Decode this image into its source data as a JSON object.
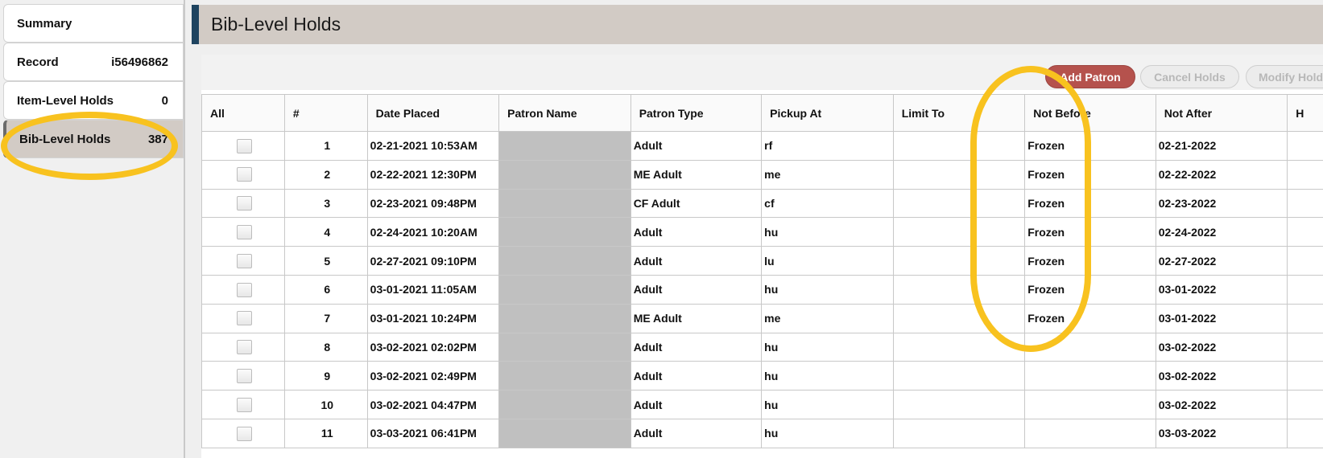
{
  "sidebar": {
    "items": [
      {
        "label": "Summary",
        "value": ""
      },
      {
        "label": "Record",
        "value": "i56496862"
      },
      {
        "label": "Item-Level Holds",
        "value": "0"
      },
      {
        "label": "Bib-Level Holds",
        "value": "387"
      }
    ]
  },
  "page": {
    "title": "Bib-Level Holds"
  },
  "toolbar": {
    "add_patron": "Add Patron",
    "cancel_holds": "Cancel Holds",
    "modify_holds": "Modify Holds"
  },
  "table": {
    "headers": [
      "All",
      "#",
      "Date Placed",
      "Patron Name",
      "Patron Type",
      "Pickup At",
      "Limit To",
      "Not Before",
      "Not After",
      "H"
    ],
    "rows": [
      {
        "num": "1",
        "date": "02-21-2021 10:53AM",
        "ptype": "Adult",
        "pickup": "rf",
        "limit": "",
        "notbefore": "Frozen",
        "notafter": "02-21-2022"
      },
      {
        "num": "2",
        "date": "02-22-2021 12:30PM",
        "ptype": "ME Adult",
        "pickup": "me",
        "limit": "",
        "notbefore": "Frozen",
        "notafter": "02-22-2022"
      },
      {
        "num": "3",
        "date": "02-23-2021 09:48PM",
        "ptype": "CF Adult",
        "pickup": "cf",
        "limit": "",
        "notbefore": "Frozen",
        "notafter": "02-23-2022"
      },
      {
        "num": "4",
        "date": "02-24-2021 10:20AM",
        "ptype": "Adult",
        "pickup": "hu",
        "limit": "",
        "notbefore": "Frozen",
        "notafter": "02-24-2022"
      },
      {
        "num": "5",
        "date": "02-27-2021 09:10PM",
        "ptype": "Adult",
        "pickup": "lu",
        "limit": "",
        "notbefore": "Frozen",
        "notafter": "02-27-2022"
      },
      {
        "num": "6",
        "date": "03-01-2021 11:05AM",
        "ptype": "Adult",
        "pickup": "hu",
        "limit": "",
        "notbefore": "Frozen",
        "notafter": "03-01-2022"
      },
      {
        "num": "7",
        "date": "03-01-2021 10:24PM",
        "ptype": "ME Adult",
        "pickup": "me",
        "limit": "",
        "notbefore": "Frozen",
        "notafter": "03-01-2022"
      },
      {
        "num": "8",
        "date": "03-02-2021 02:02PM",
        "ptype": "Adult",
        "pickup": "hu",
        "limit": "",
        "notbefore": "",
        "notafter": "03-02-2022"
      },
      {
        "num": "9",
        "date": "03-02-2021 02:49PM",
        "ptype": "Adult",
        "pickup": "hu",
        "limit": "",
        "notbefore": "",
        "notafter": "03-02-2022"
      },
      {
        "num": "10",
        "date": "03-02-2021 04:47PM",
        "ptype": "Adult",
        "pickup": "hu",
        "limit": "",
        "notbefore": "",
        "notafter": "03-02-2022"
      },
      {
        "num": "11",
        "date": "03-03-2021 06:41PM",
        "ptype": "Adult",
        "pickup": "hu",
        "limit": "",
        "notbefore": "",
        "notafter": "03-03-2022"
      }
    ]
  },
  "colors": {
    "accent": "#1f4460",
    "highlight": "#f8c21f",
    "add_button": "#b5524d",
    "active_tab": "#d2cbc5"
  }
}
